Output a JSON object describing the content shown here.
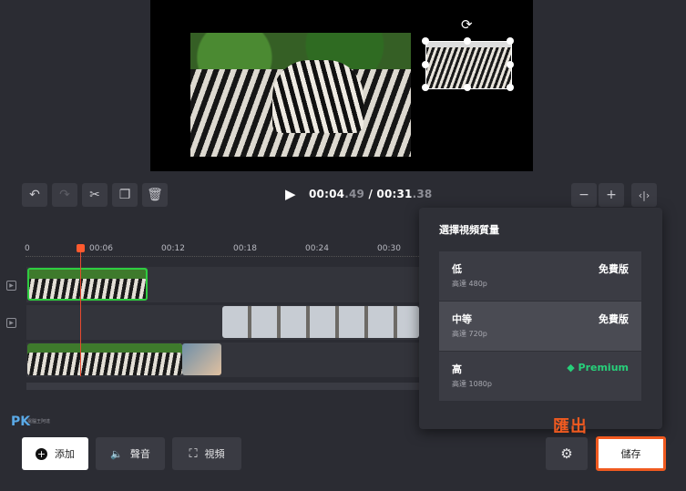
{
  "playback": {
    "current_main": "00:04",
    "current_frac": ".49",
    "separator": " / ",
    "total_main": "00:31",
    "total_frac": ".38"
  },
  "ruler": {
    "ticks": [
      "0",
      "00:06",
      "00:12",
      "00:18",
      "00:24",
      "00:30"
    ]
  },
  "quality_popup": {
    "title": "選擇視頻質量",
    "options": [
      {
        "name": "低",
        "sub": "高達 480p",
        "tier": "免費版"
      },
      {
        "name": "中等",
        "sub": "高達 720p",
        "tier": "免費版"
      },
      {
        "name": "高",
        "sub": "高達 1080p",
        "tier": "Premium"
      }
    ]
  },
  "bottom": {
    "add_label": "添加",
    "audio_label": "聲音",
    "video_label": "視頻",
    "save_label": "儲存",
    "export_annotation": "匯出"
  },
  "watermark": {
    "logo": "PK",
    "sub": "電腦王阿達"
  },
  "colors": {
    "accent": "#f05a20",
    "premium": "#27d07a",
    "playhead": "#e84a2e",
    "clip_selected": "#2ecc40"
  }
}
